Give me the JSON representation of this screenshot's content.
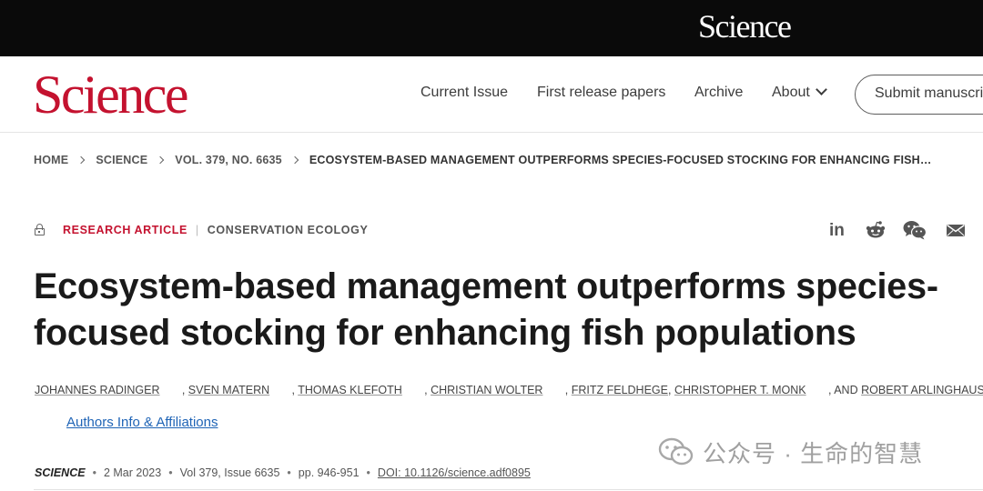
{
  "topbar": {
    "logo": "Science"
  },
  "header": {
    "logo": "Science",
    "nav": {
      "current_issue": "Current Issue",
      "first_release": "First release papers",
      "archive": "Archive",
      "about": "About"
    },
    "submit_label": "Submit manuscript"
  },
  "breadcrumb": {
    "items": [
      "HOME",
      "SCIENCE",
      "VOL. 379, NO. 6635",
      "ECOSYSTEM-BASED MANAGEMENT OUTPERFORMS SPECIES-FOCUSED STOCKING FOR ENHANCING FISH…"
    ]
  },
  "article": {
    "type": "RESEARCH ARTICLE",
    "subject": "CONSERVATION ECOLOGY",
    "title": "Ecosystem-based management outperforms species-focused stocking for enhancing fish populations",
    "authors": [
      "JOHANNES RADINGER",
      "SVEN MATERN",
      "THOMAS KLEFOTH",
      "CHRISTIAN WOLTER",
      "FRITZ FELDHEGE",
      "CHRISTOPHER T. MONK",
      "ROBERT ARLINGHAUS"
    ],
    "and_label": "AND",
    "affiliations_link": "Authors Info & Affiliations",
    "journal": "SCIENCE",
    "date": "2 Mar 2023",
    "volume_issue": "Vol 379, Issue 6635",
    "pages": "pp. 946-951",
    "doi": "DOI: 10.1126/science.adf0895"
  },
  "share": {
    "icons": [
      "linkedin-icon",
      "reddit-icon",
      "wechat-icon",
      "email-icon"
    ],
    "linkedin_text": "in"
  },
  "watermark": {
    "text": "公众号 · 生命的智慧"
  },
  "colors": {
    "brand_red": "#c4122f",
    "link_blue": "#1f64b6",
    "topbar": "#0a0a0a"
  }
}
